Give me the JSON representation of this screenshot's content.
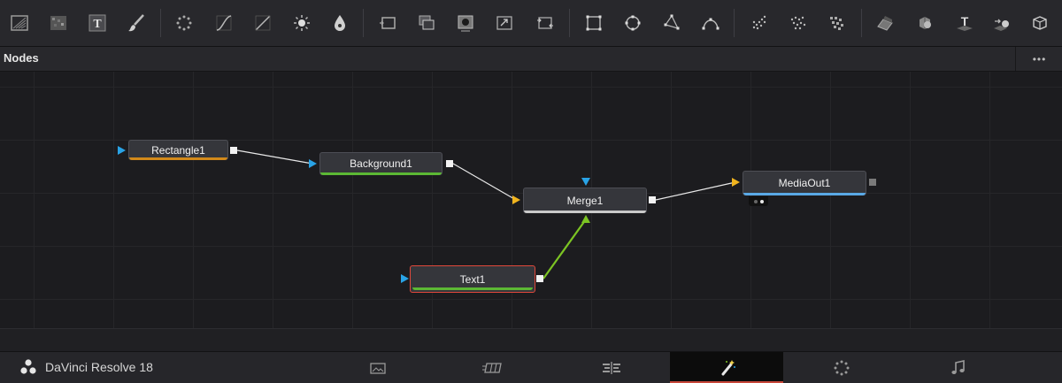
{
  "toolbar": {
    "tools": [
      {
        "icon": "gradient-background-icon"
      },
      {
        "icon": "fast-noise-icon"
      },
      {
        "icon": "text-icon"
      },
      {
        "icon": "paint-brush-icon"
      },
      {
        "icon": "particle-emitter-icon"
      },
      {
        "icon": "color-curves-icon"
      },
      {
        "icon": "brightness-contrast-icon"
      },
      {
        "icon": "color-corrector-icon"
      },
      {
        "icon": "blur-icon"
      },
      {
        "icon": "background-icon"
      },
      {
        "icon": "merge-icon"
      },
      {
        "icon": "matte-control-icon"
      },
      {
        "icon": "resize-icon"
      },
      {
        "icon": "transform-icon"
      },
      {
        "icon": "rectangle-mask-icon"
      },
      {
        "icon": "ellipse-mask-icon"
      },
      {
        "icon": "polygon-mask-icon"
      },
      {
        "icon": "bspline-mask-icon"
      },
      {
        "icon": "particle-render-icon"
      },
      {
        "icon": "particle-style-icon"
      },
      {
        "icon": "particle-pixel-icon"
      },
      {
        "icon": "image-plane-3d-icon"
      },
      {
        "icon": "shape-3d-icon"
      },
      {
        "icon": "text-3d-icon"
      },
      {
        "icon": "renderer-3d-icon"
      },
      {
        "icon": "merge-3d-icon"
      }
    ]
  },
  "panel": {
    "title": "Nodes",
    "menu_label": "•••"
  },
  "nodes": {
    "rectangle": {
      "label": "Rectangle1",
      "accent": "#d2891a"
    },
    "background": {
      "label": "Background1",
      "accent": "#5cb834"
    },
    "merge": {
      "label": "Merge1",
      "accent": "#c9c9c9"
    },
    "text": {
      "label": "Text1",
      "accent": "#5cb834",
      "selected_color": "#e0473a"
    },
    "mediaout": {
      "label": "MediaOut1",
      "accent": "#5aa9e6"
    }
  },
  "colors": {
    "input_blue": "#29a3e6",
    "input_yellow": "#f0b41e",
    "input_green": "#7cc423",
    "wire": "#e8e8e8",
    "wire_green": "#7cc423"
  },
  "app": {
    "name": "DaVinci Resolve 18"
  },
  "pages": [
    {
      "icon": "media-page-icon",
      "active": false
    },
    {
      "icon": "cut-page-icon",
      "active": false
    },
    {
      "icon": "edit-page-icon",
      "active": false
    },
    {
      "icon": "fusion-page-icon",
      "active": true
    },
    {
      "icon": "color-page-icon",
      "active": false
    },
    {
      "icon": "fairlight-page-icon",
      "active": false
    }
  ]
}
